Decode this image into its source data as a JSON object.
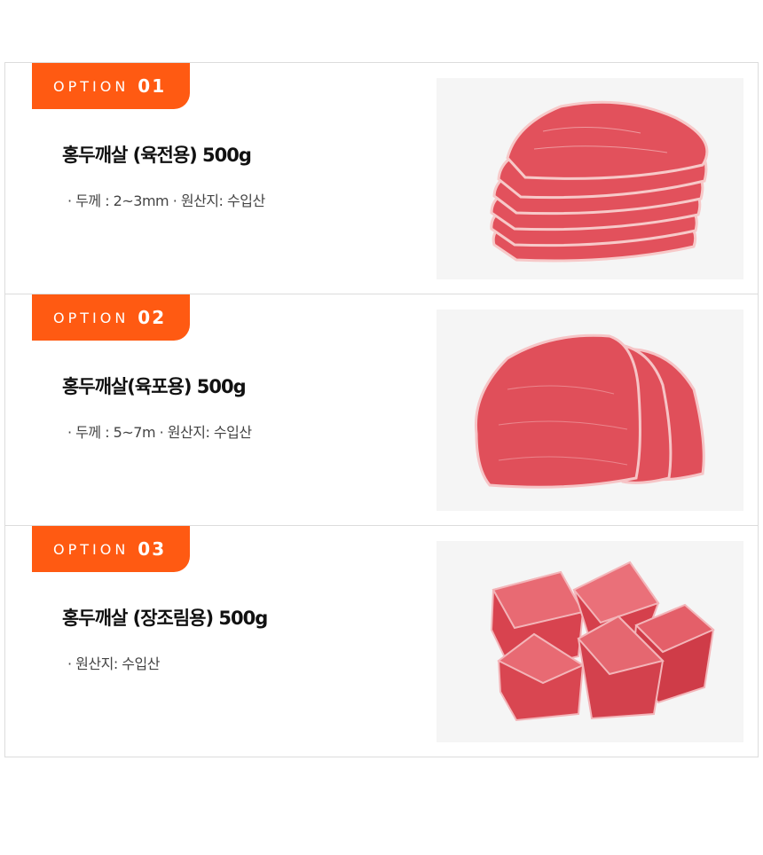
{
  "options": [
    {
      "label": "OPTION",
      "number": "01",
      "title": "홍두깨살 (육전용) 500g",
      "specs": "· 두께 : 2~3mm  · 원산지: 수입산",
      "image_icon": "sliced-beef-photo"
    },
    {
      "label": "OPTION",
      "number": "02",
      "title": "홍두깨살(육포용) 500g",
      "specs": "· 두께 : 5~7m  · 원산지: 수입산",
      "image_icon": "thick-sliced-beef-photo"
    },
    {
      "label": "OPTION",
      "number": "03",
      "title": "홍두깨살 (장조림용) 500g",
      "specs": "· 원산지: 수입산",
      "image_icon": "cubed-beef-photo"
    }
  ],
  "colors": {
    "accent": "#ff5a12",
    "border": "#dcdcdc",
    "meat": "#e04a55"
  }
}
